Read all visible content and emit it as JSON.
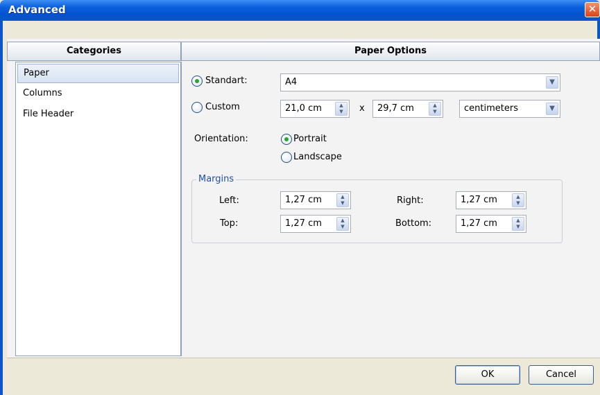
{
  "window": {
    "title": "Advanced",
    "close_icon": "close-icon"
  },
  "categories": {
    "header": "Categories",
    "items": [
      {
        "label": "Paper",
        "selected": true
      },
      {
        "label": "Columns",
        "selected": false
      },
      {
        "label": "File Header",
        "selected": false
      }
    ]
  },
  "paper_options": {
    "header": "Paper Options",
    "standart": {
      "label": "Standart:",
      "checked": true,
      "value": "A4"
    },
    "custom": {
      "label": "Custom",
      "checked": false,
      "width": "21,0 cm",
      "separator": "x",
      "height": "29,7 cm",
      "unit": "centimeters"
    },
    "orientation": {
      "label": "Orientation:",
      "portrait": {
        "label": "Portrait",
        "checked": true
      },
      "landscape": {
        "label": "Landscape",
        "checked": false
      }
    },
    "margins": {
      "legend": "Margins",
      "left": {
        "label": "Left:",
        "value": "1,27 cm"
      },
      "right": {
        "label": "Right:",
        "value": "1,27 cm"
      },
      "top": {
        "label": "Top:",
        "value": "1,27 cm"
      },
      "bottom": {
        "label": "Bottom:",
        "value": "1,27 cm"
      }
    }
  },
  "footer": {
    "ok_label": "OK",
    "cancel_label": "Cancel"
  },
  "colors": {
    "titlebar": "#0453cf",
    "radio_checked": "#27a531",
    "margins_legend": "#1f4fa8"
  }
}
